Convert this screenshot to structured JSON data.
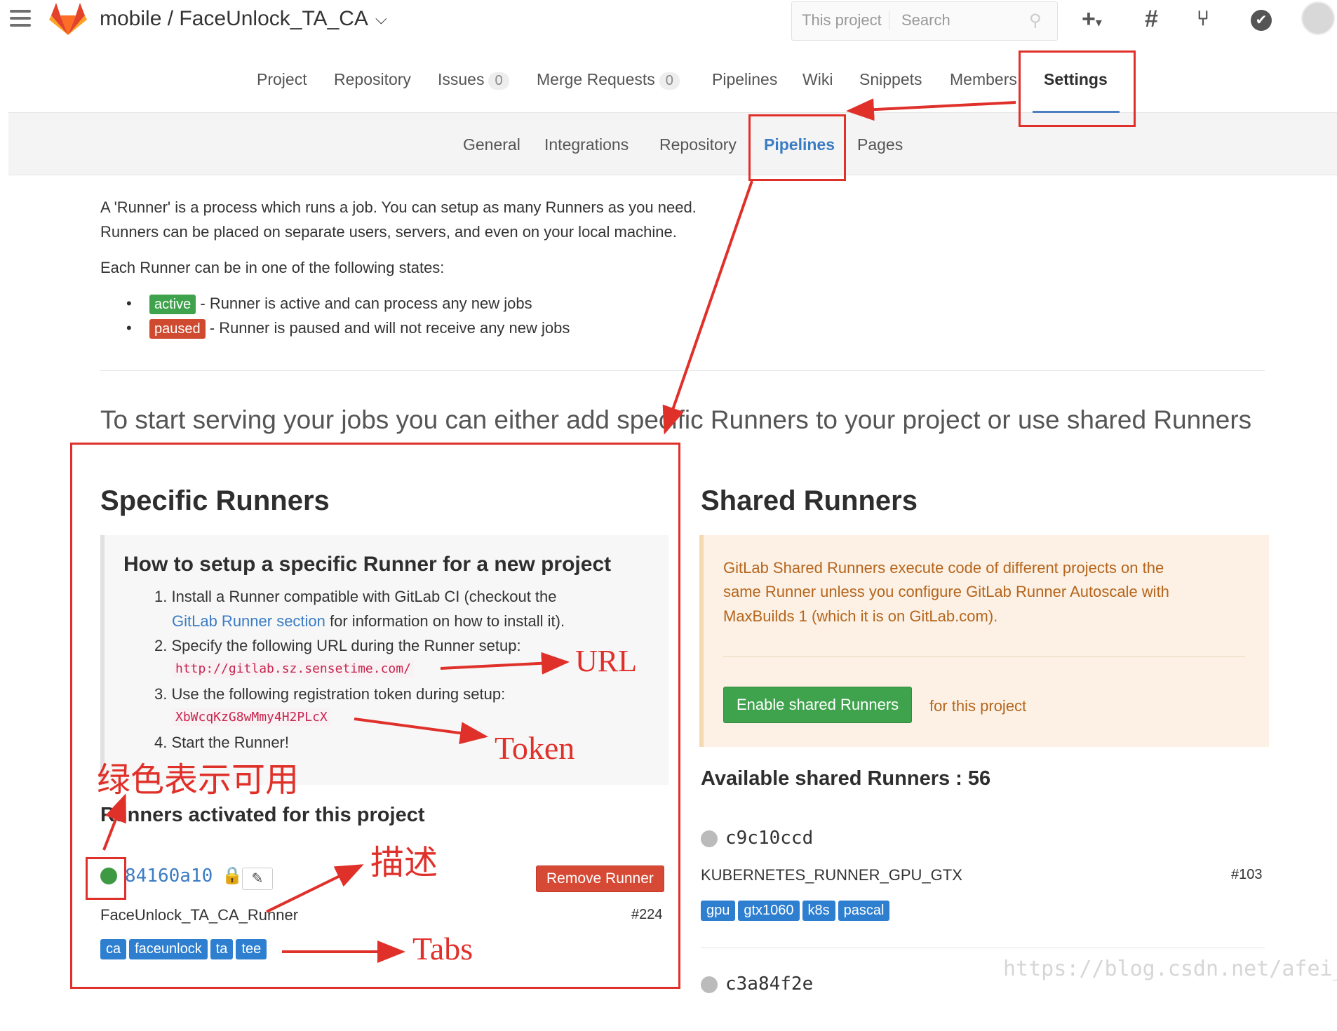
{
  "header": {
    "title": "mobile / FaceUnlock_TA_CA",
    "search_scope": "This project",
    "search_placeholder": "Search"
  },
  "nav": {
    "tabs": [
      {
        "label": "Project"
      },
      {
        "label": "Repository"
      },
      {
        "label": "Issues",
        "count": "0"
      },
      {
        "label": "Merge Requests",
        "count": "0"
      },
      {
        "label": "Pipelines"
      },
      {
        "label": "Wiki"
      },
      {
        "label": "Snippets"
      },
      {
        "label": "Members"
      },
      {
        "label": "Settings"
      }
    ]
  },
  "subnav": {
    "tabs": [
      "General",
      "Integrations",
      "Repository",
      "Pipelines",
      "Pages"
    ]
  },
  "intro": {
    "line1": "A 'Runner' is a process which runs a job. You can setup as many Runners as you need.",
    "line2": "Runners can be placed on separate users, servers, and even on your local machine.",
    "states_heading": "Each Runner can be in one of the following states:",
    "active_label": "active",
    "active_desc": "- Runner is active and can process any new jobs",
    "paused_label": "paused",
    "paused_desc": "- Runner is paused and will not receive any new jobs",
    "big": "To start serving your jobs you can either add specific Runners to your project or use shared Runners"
  },
  "specific": {
    "title": "Specific Runners",
    "howto_title": "How to setup a specific Runner for a new project",
    "step1a": "1. Install a Runner compatible with GitLab CI (checkout the",
    "step1_link": "GitLab Runner section",
    "step1b": " for information on how to install it).",
    "step2": "2. Specify the following URL during the Runner setup:",
    "url": "http://gitlab.sz.sensetime.com/",
    "step3": "3. Use the following registration token during setup:",
    "token": "XbWcqKzG8wMmy4H2PLcX",
    "step4": "4. Start the Runner!",
    "activated_title": "Runners activated for this project",
    "runner": {
      "token": "84160a10",
      "description": "FaceUnlock_TA_CA_Runner",
      "id": "#224",
      "remove_label": "Remove Runner",
      "tags": [
        "ca",
        "faceunlock",
        "ta",
        "tee"
      ]
    }
  },
  "shared": {
    "title": "Shared Runners",
    "warn1": "GitLab Shared Runners execute code of different projects on the",
    "warn2": "same Runner unless you configure GitLab Runner Autoscale with",
    "warn3": "MaxBuilds 1 (which it is on GitLab.com).",
    "enable_label": "Enable shared Runners",
    "enable_suffix": "for this project",
    "available": "Available shared Runners : 56",
    "runners": [
      {
        "token": "c9c10ccd",
        "description": "KUBERNETES_RUNNER_GPU_GTX",
        "id": "#103",
        "tags": [
          "gpu",
          "gtx1060",
          "k8s",
          "pascal"
        ]
      },
      {
        "token": "c3a84f2e"
      }
    ]
  },
  "annotations": {
    "url": "URL",
    "token": "Token",
    "green": "绿色表示可用",
    "desc": "描述",
    "tabs": "Tabs",
    "color": "#e0302a"
  },
  "watermark": "https://blog.csdn.net/afei__"
}
